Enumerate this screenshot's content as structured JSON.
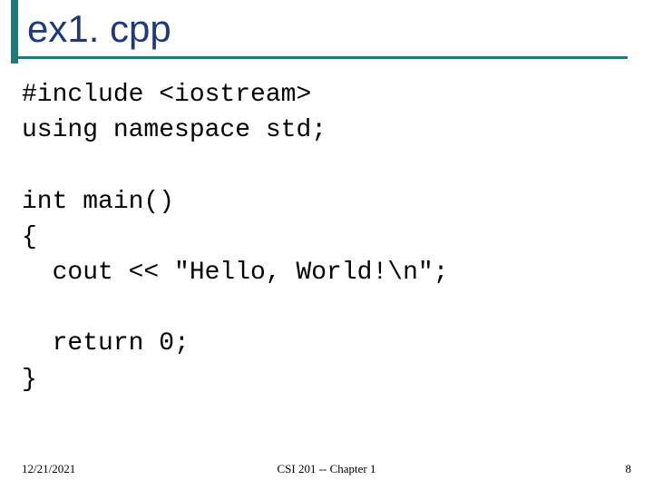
{
  "slide": {
    "title": "ex1. cpp"
  },
  "code": {
    "line1": "#include <iostream>",
    "line2": "using namespace std;",
    "line3": "",
    "line4": "int main()",
    "line5": "{",
    "line6": "  cout << \"Hello, World!\\n\";",
    "line7": "",
    "line8": "  return 0;",
    "line9": "}"
  },
  "footer": {
    "date": "12/21/2021",
    "center": "CSI 201 -- Chapter 1",
    "page": "8"
  }
}
